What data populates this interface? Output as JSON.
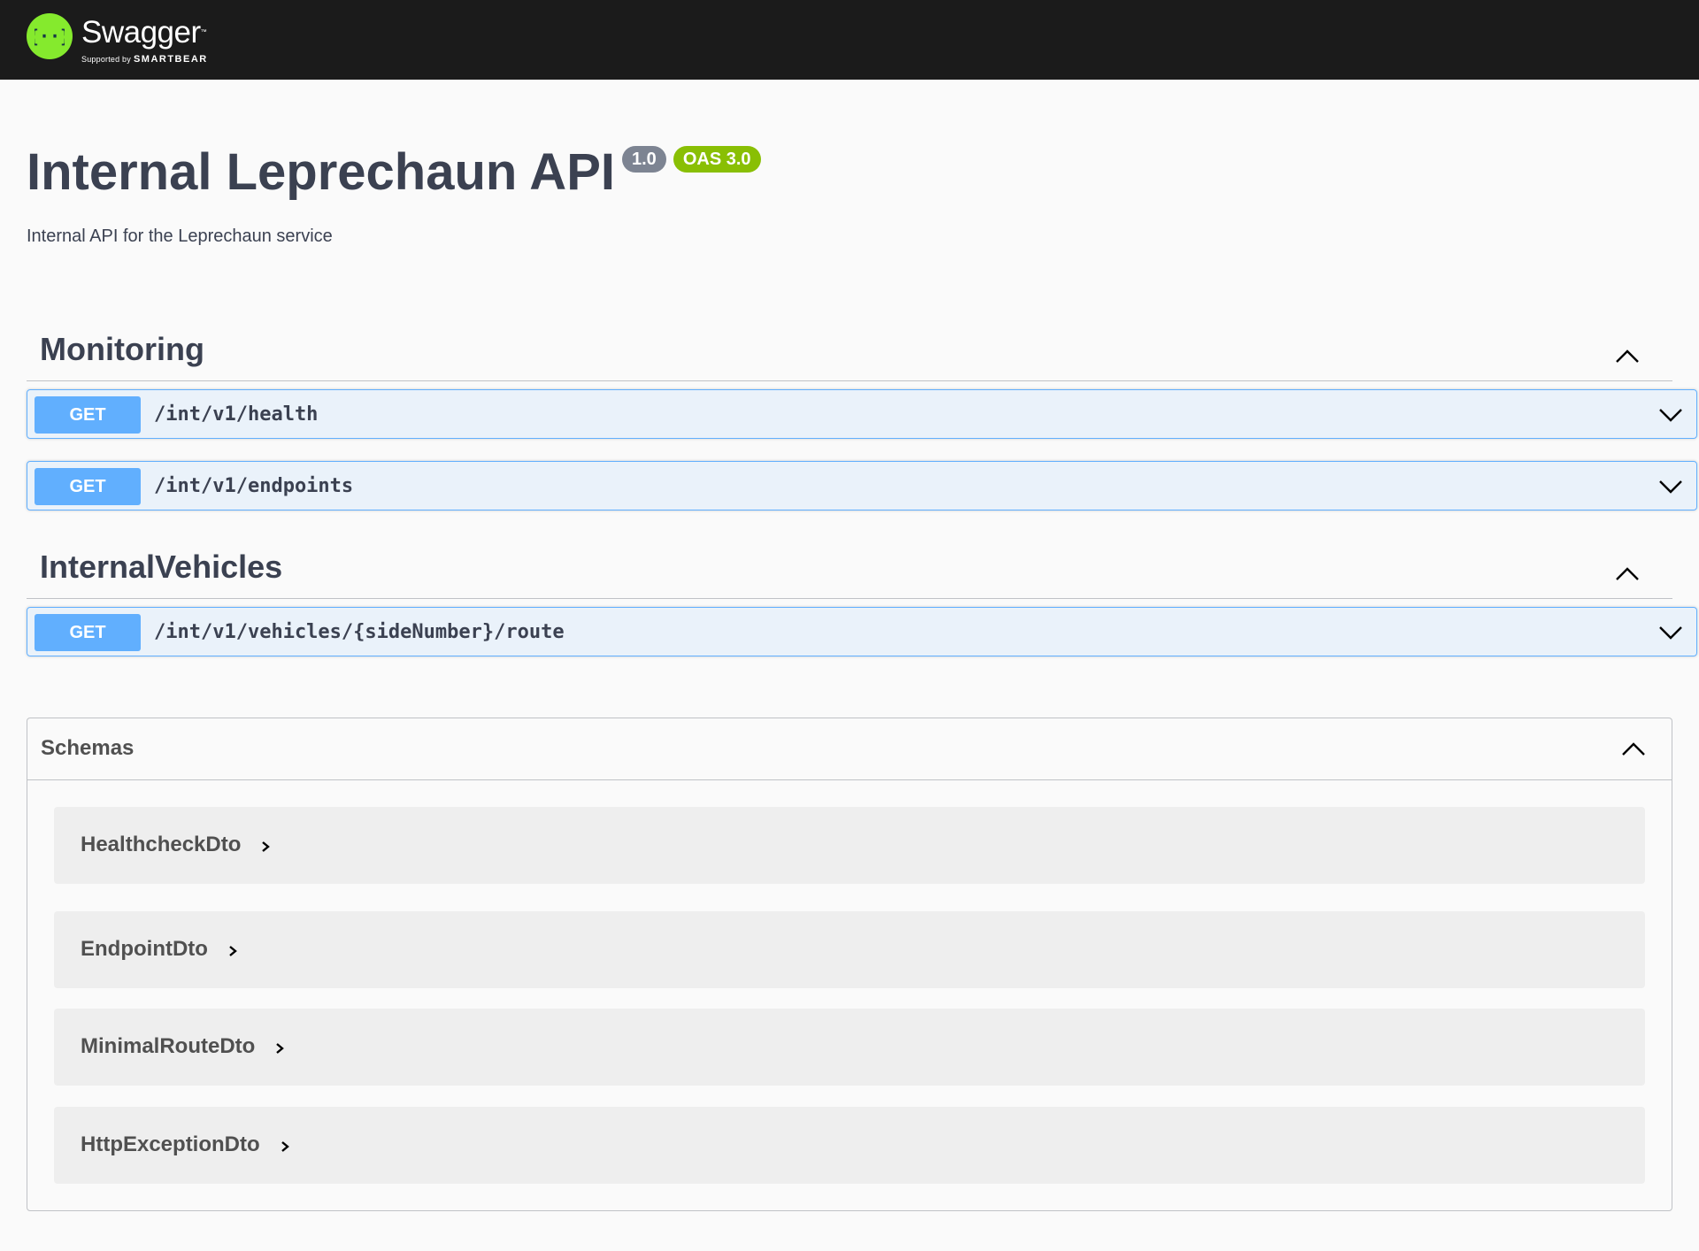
{
  "topbar": {
    "logo_name": "Swagger",
    "logo_tm": "™",
    "supported_by": "Supported by",
    "smartbear": "SMARTBEAR"
  },
  "info": {
    "title": "Internal Leprechaun API",
    "version": "1.0",
    "oas": "OAS 3.0",
    "description": "Internal API for the Leprechaun service"
  },
  "sections": [
    {
      "name": "Monitoring",
      "operations": [
        {
          "method": "GET",
          "path": "/int/v1/health"
        },
        {
          "method": "GET",
          "path": "/int/v1/endpoints"
        }
      ]
    },
    {
      "name": "InternalVehicles",
      "operations": [
        {
          "method": "GET",
          "path": "/int/v1/vehicles/{sideNumber}/route"
        }
      ]
    }
  ],
  "schemas": {
    "title": "Schemas",
    "models": [
      "HealthcheckDto",
      "EndpointDto",
      "MinimalRouteDto",
      "HttpExceptionDto"
    ]
  },
  "colors": {
    "get": "#61affe",
    "topbar": "#1b1b1b",
    "logo": "#85ea2d",
    "oas_badge": "#89bf04",
    "version_badge": "#7d8492"
  }
}
